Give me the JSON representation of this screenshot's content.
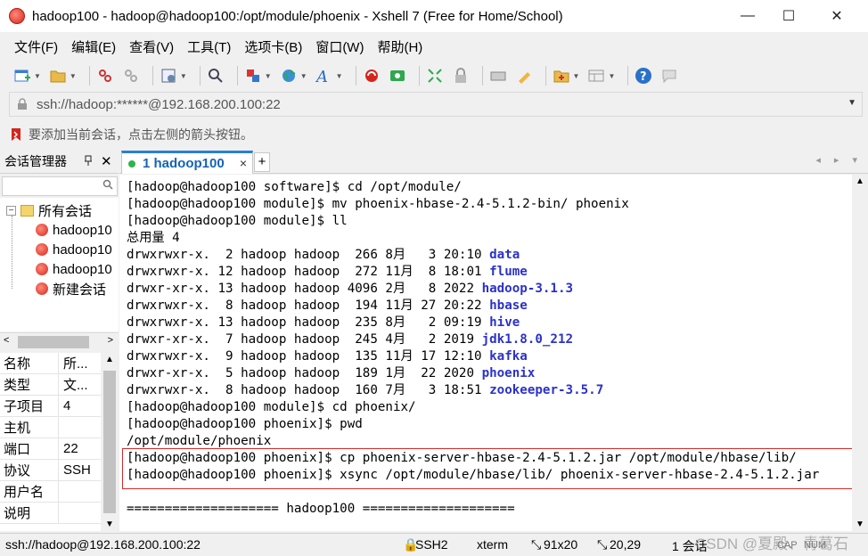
{
  "window": {
    "title": "hadoop100 - hadoop@hadoop100:/opt/module/phoenix - Xshell 7 (Free for Home/School)",
    "minimize": "—",
    "maximize": "☐",
    "close": "✕"
  },
  "menu": [
    "文件(F)",
    "编辑(E)",
    "查看(V)",
    "工具(T)",
    "选项卡(B)",
    "窗口(W)",
    "帮助(H)"
  ],
  "address": {
    "value": "ssh://hadoop:******@192.168.200.100:22",
    "arrow": "▼"
  },
  "hint": "要添加当前会话，点击左侧的箭头按钮。",
  "session_panel": {
    "title": "会话管理器",
    "pin": "📌",
    "close": "✕",
    "tree": {
      "root_label": "所有会话",
      "expander": "⊟",
      "items": [
        "hadoop10",
        "hadoop10",
        "hadoop10",
        "新建会话"
      ]
    },
    "scroll_left": "<",
    "scroll_right": ">",
    "props": [
      {
        "key": "名称",
        "value": "所..."
      },
      {
        "key": "类型",
        "value": "文..."
      },
      {
        "key": "子项目",
        "value": "4"
      },
      {
        "key": "主机",
        "value": ""
      },
      {
        "key": "端口",
        "value": "22"
      },
      {
        "key": "协议",
        "value": "SSH"
      },
      {
        "key": "用户名",
        "value": ""
      },
      {
        "key": "说明",
        "value": ""
      }
    ]
  },
  "tabs": {
    "active_label": "1 hadoop100",
    "close": "×",
    "add": "+",
    "nav": "◂ ▸ ▾"
  },
  "terminal": {
    "lines": [
      {
        "prefix": "[hadoop@hadoop100 software]$ cd /opt/module/",
        "dir": ""
      },
      {
        "prefix": "[hadoop@hadoop100 module]$ mv phoenix-hbase-2.4-5.1.2-bin/ phoenix",
        "dir": ""
      },
      {
        "prefix": "[hadoop@hadoop100 module]$ ll",
        "dir": ""
      },
      {
        "prefix": "总用量 4",
        "dir": ""
      },
      {
        "prefix": "drwxrwxr-x.  2 hadoop hadoop  266 8月   3 20:10 ",
        "dir": "data"
      },
      {
        "prefix": "drwxrwxr-x. 12 hadoop hadoop  272 11月  8 18:01 ",
        "dir": "flume"
      },
      {
        "prefix": "drwxr-xr-x. 13 hadoop hadoop 4096 2月   8 2022 ",
        "dir": "hadoop-3.1.3"
      },
      {
        "prefix": "drwxrwxr-x.  8 hadoop hadoop  194 11月 27 20:22 ",
        "dir": "hbase"
      },
      {
        "prefix": "drwxrwxr-x. 13 hadoop hadoop  235 8月   2 09:19 ",
        "dir": "hive"
      },
      {
        "prefix": "drwxr-xr-x.  7 hadoop hadoop  245 4月   2 2019 ",
        "dir": "jdk1.8.0_212"
      },
      {
        "prefix": "drwxrwxr-x.  9 hadoop hadoop  135 11月 17 12:10 ",
        "dir": "kafka"
      },
      {
        "prefix": "drwxr-xr-x.  5 hadoop hadoop  189 1月  22 2020 ",
        "dir": "phoenix"
      },
      {
        "prefix": "drwxrwxr-x.  8 hadoop hadoop  160 7月   3 18:51 ",
        "dir": "zookeeper-3.5.7"
      },
      {
        "prefix": "[hadoop@hadoop100 module]$ cd phoenix/",
        "dir": ""
      },
      {
        "prefix": "[hadoop@hadoop100 phoenix]$ pwd",
        "dir": ""
      },
      {
        "prefix": "/opt/module/phoenix",
        "dir": ""
      },
      {
        "prefix": "[hadoop@hadoop100 phoenix]$ cp phoenix-server-hbase-2.4-5.1.2.jar /opt/module/hbase/lib/",
        "dir": ""
      },
      {
        "prefix": "[hadoop@hadoop100 phoenix]$ xsync /opt/module/hbase/lib/ phoenix-server-hbase-2.4-5.1.2.jar",
        "dir": ""
      },
      {
        "prefix": "",
        "dir": ""
      },
      {
        "prefix": "==================== hadoop100 ====================",
        "dir": ""
      }
    ],
    "scroll_up": "▲",
    "scroll_down": "▼"
  },
  "statusbar": {
    "connection": "ssh://hadoop@192.168.200.100:22",
    "protocol": "SSH2",
    "term": "xterm",
    "size": "91x20",
    "cursor": "20,29",
    "sessions": "1 会话",
    "caps": "CAP",
    "num": "NUM"
  },
  "watermark": "CSDN @夏殿、青葛石",
  "colors": {
    "dir_blue": "#2b32c9",
    "tab_accent": "#2a7fd4",
    "highlight_red": "#d62b2b",
    "status_green": "#2fb34a"
  }
}
